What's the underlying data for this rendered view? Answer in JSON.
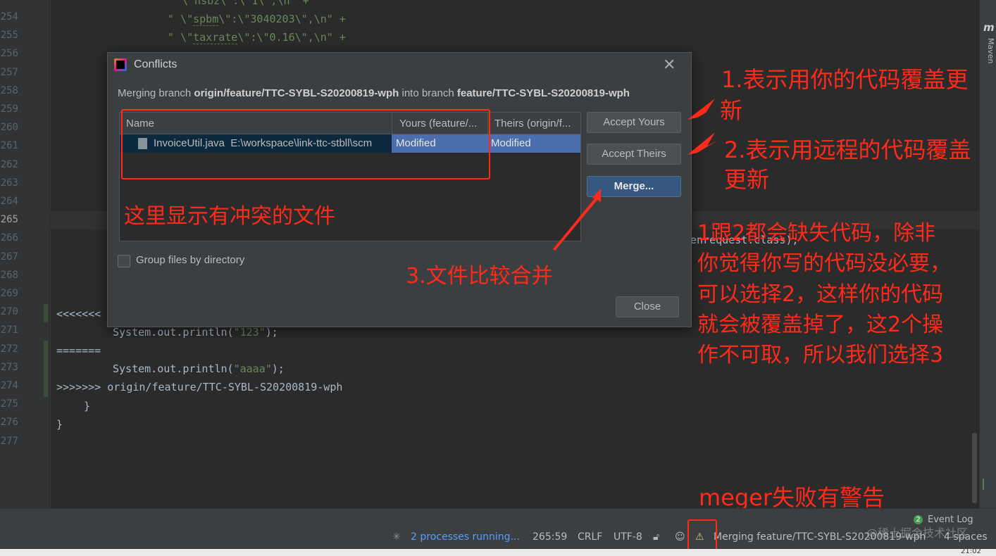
{
  "editor": {
    "line_numbers": [
      "254",
      "255",
      "256",
      "257",
      "258",
      "259",
      "260",
      "261",
      "262",
      "263",
      "264",
      "265",
      "266",
      "267",
      "268",
      "269",
      "270",
      "271",
      "272",
      "273",
      "274",
      "275",
      "276",
      "277"
    ],
    "current_line": "265",
    "code": {
      "l253": "\\\"nsbz\\\":\\\"1\\\",\\n\" +",
      "l254_prefix": "\" \\\"",
      "l254_key": "spbm",
      "l254_suffix": "\\\":\\\"3040203\\\",\\n\" +",
      "l255_prefix": "\" \\\"",
      "l255_key": "taxrate",
      "l255_suffix": "\\\":\\\"0.16\\\",\\n\" +",
      "l266_tail": "enrequest.class);",
      "l270": "<<<<<<<",
      "l271_a": "System.out.println(",
      "l271_s": "\"123\"",
      "l271_b": ");",
      "l272": "=======",
      "l273_a": "System.out.println(",
      "l273_s": "\"aaaa\"",
      "l273_b": ");",
      "l274": ">>>>>>> origin/feature/TTC-SYBL-S20200819-wph",
      "l275": "}",
      "l276": "}"
    }
  },
  "right_strip": {
    "maven_icon": "m",
    "maven_label": "Maven"
  },
  "dialog": {
    "title": "Conflicts",
    "subtitle_a": "Merging branch ",
    "subtitle_branch1": "origin/feature/TTC-SYBL-S20200819-wph",
    "subtitle_b": " into branch ",
    "subtitle_branch2": "feature/TTC-SYBL-S20200819-wph",
    "table": {
      "headers": [
        "Name",
        "Yours (feature/...",
        "Theirs (origin/f..."
      ],
      "rows": [
        {
          "name": "InvoiceUtil.java",
          "path": "E:\\workspace\\link-ttc-stbll\\scm",
          "yours": "Modified",
          "theirs": "Modified"
        }
      ]
    },
    "buttons": {
      "accept_yours": "Accept Yours",
      "accept_theirs": "Accept Theirs",
      "merge": "Merge...",
      "close": "Close"
    },
    "group_by_directory": "Group files by directory"
  },
  "annotations": {
    "a1_line1": "1.表示用你的代码覆盖更",
    "a1_line2": "新",
    "a2_line1": "2.表示用远程的代码覆盖",
    "a2_line2": "更新",
    "a_conflict": "这里显示有冲突的文件",
    "a3": "3.文件比较合并",
    "note": [
      "1跟2都会缺失代码，除非",
      "你觉得你写的代码没必要，",
      "可以选择2，这样你的代码",
      "就会被覆盖掉了，这2个操",
      "作不可取，所以我们选择3"
    ],
    "warning_note": "meger失败有警告"
  },
  "statusbar": {
    "event_count": "2",
    "event_log": "Event Log",
    "processes": "2 processes running...",
    "position": "265:59",
    "line_sep": "CRLF",
    "encoding": "UTF-8",
    "vcs": "Merging feature/TTC-SYBL-S20200819-wph",
    "indent": "4 spaces",
    "watermark": "@稀土掘金技术社区",
    "clock": "21:02"
  }
}
